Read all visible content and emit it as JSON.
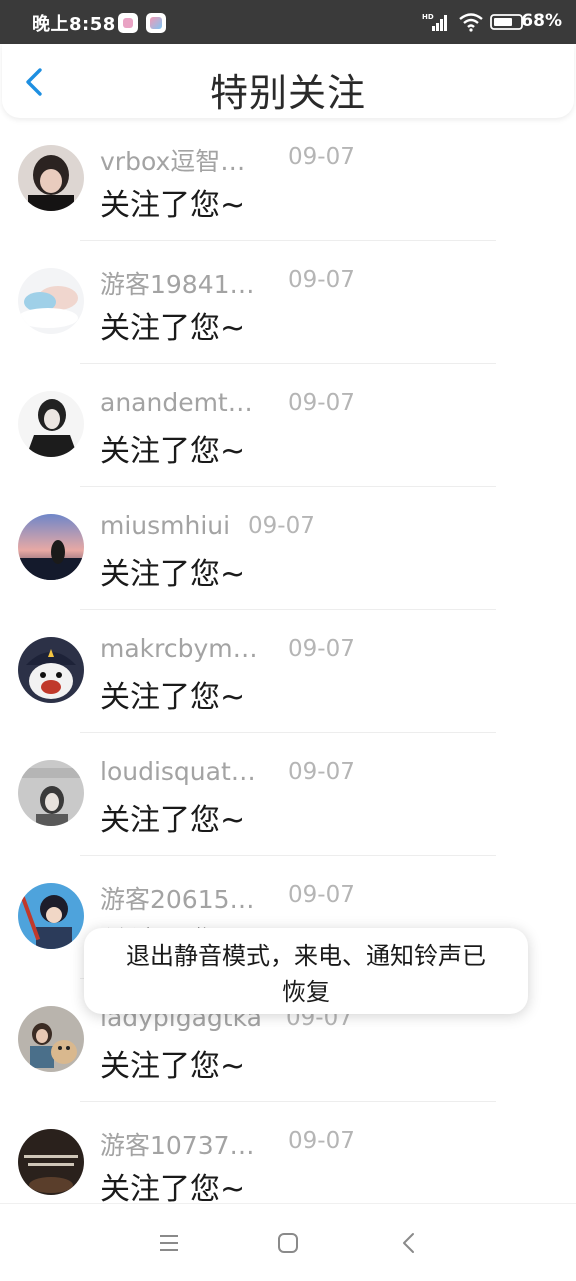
{
  "status_bar": {
    "time": "晚上8:58",
    "battery": "68%",
    "icons": [
      "app-notification-icon",
      "photos-icon",
      "hd-signal-icon",
      "wifi-icon",
      "battery-icon"
    ]
  },
  "header": {
    "title": "特别关注",
    "back_icon": "chevron-left-icon"
  },
  "colors": {
    "accent": "#1e8fe1",
    "name_text": "#a3a3a3",
    "date_text": "#b5b5b5",
    "message_text": "#1a1a1a",
    "status_bar_bg": "#3a3a3a"
  },
  "follows": [
    {
      "name": "vrbox逗智…",
      "date": "09-07",
      "message": "关注了您~"
    },
    {
      "name": "游客19841…",
      "date": "09-07",
      "message": "关注了您~"
    },
    {
      "name": "anandemt…",
      "date": "09-07",
      "message": "关注了您~"
    },
    {
      "name": "miusmhiui",
      "date": "09-07",
      "message": "关注了您~"
    },
    {
      "name": "makrcbym…",
      "date": "09-07",
      "message": "关注了您~"
    },
    {
      "name": "loudisquat…",
      "date": "09-07",
      "message": "关注了您~"
    },
    {
      "name": "游客20615…",
      "date": "09-07",
      "message": "关注了您~"
    },
    {
      "name": "ladyplgagtka",
      "date": "09-07",
      "message": "关注了您~"
    },
    {
      "name": "游客10737…",
      "date": "09-07",
      "message": "关注了您~"
    }
  ],
  "toast": {
    "text": "退出静音模式，来电、通知铃声已恢复"
  },
  "nav_bar": {
    "icons": [
      "menu-icon",
      "home-icon",
      "back-icon"
    ]
  }
}
